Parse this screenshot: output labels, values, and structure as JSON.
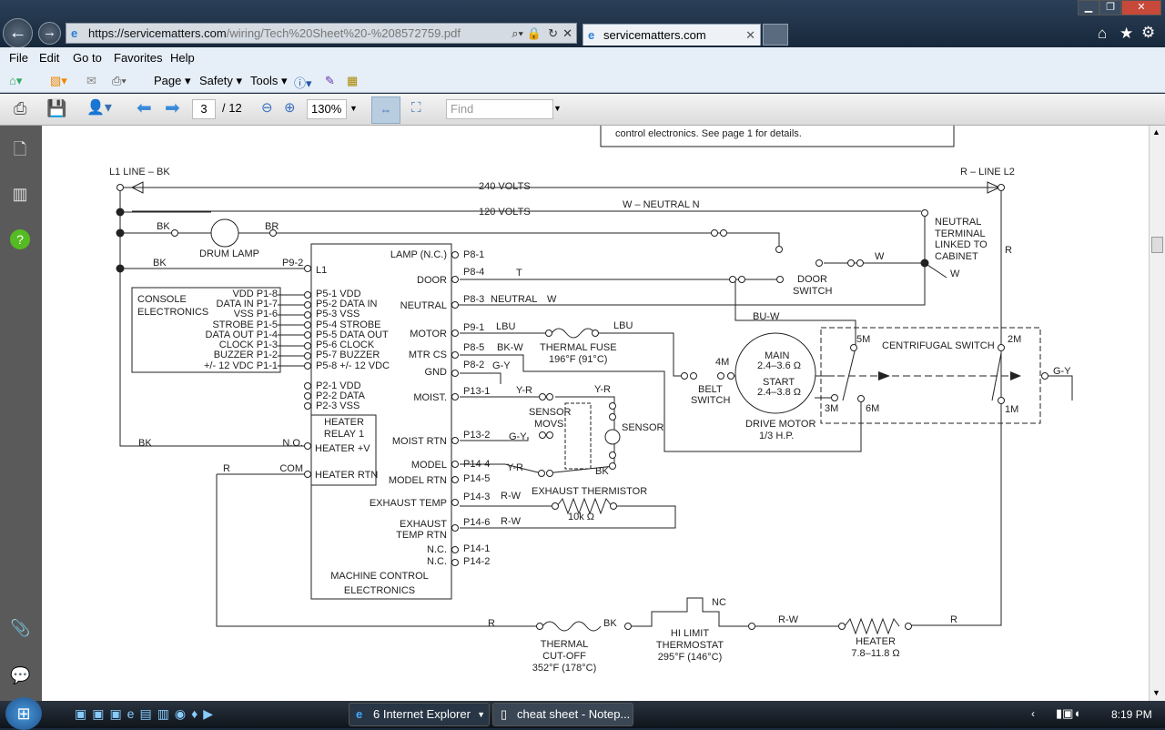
{
  "browser": {
    "url_host": "https://servicematters.com",
    "url_path": "/wiring/Tech%20Sheet%20-%208572759.pdf",
    "tab_title": "servicematters.com",
    "menu": [
      "File",
      "Edit",
      "Go to",
      "Favorites",
      "Help"
    ],
    "command_bar": [
      "Page ▾",
      "Safety ▾",
      "Tools ▾"
    ]
  },
  "pdf_toolbar": {
    "page_current": "3",
    "page_total": "/ 12",
    "zoom": "130%",
    "find_placeholder": "Find"
  },
  "taskbar": {
    "items": [
      "6 Internet Explorer",
      "cheat sheet - Notep..."
    ],
    "clock": "8:19 PM"
  },
  "diagram": {
    "labels": [
      "control electronics. See page 1 for details.",
      "L1 LINE – BK",
      "R – LINE L2",
      "240 VOLTS",
      "120 VOLTS",
      "W – NEUTRAL N",
      "BK",
      "BR",
      "DRUM LAMP",
      "NEUTRAL",
      "TERMINAL",
      "LINKED TO",
      "CABINET",
      "R",
      "BK",
      "P9-2",
      "L1",
      "LAMP (N.C.)",
      "P8-1",
      "DOOR",
      "P8-4",
      "T",
      "DOOR",
      "SWITCH",
      "W",
      "W",
      "NEUTRAL",
      "P8-3",
      "NEUTRAL",
      "W",
      "CONSOLE",
      "ELECTRONICS",
      "VDD P1-8",
      "DATA IN P1-7",
      "VSS P1-6",
      "STROBE P1-5",
      "DATA OUT P1-4",
      "CLOCK P1-3",
      "BUZZER P1-2",
      "+/- 12 VDC P1-1",
      "P5-1 VDD",
      "P5-2 DATA IN",
      "P5-3 VSS",
      "P5-4 STROBE",
      "P5-5 DATA OUT",
      "P5-6 CLOCK",
      "P5-7 BUZZER",
      "P5-8 +/- 12 VDC",
      "P2-1 VDD",
      "P2-2 DATA",
      "P2-3 VSS",
      "HEATER",
      "RELAY 1",
      "N.O.",
      "HEATER +V",
      "BK",
      "R",
      "COM",
      "HEATER RTN",
      "MOTOR",
      "P9-1",
      "LBU",
      "THERMAL FUSE",
      "196°F (91°C)",
      "LBU",
      "MTR CS",
      "P8-5",
      "BK-W",
      "GND",
      "P8-2",
      "G-Y",
      "MOIST.",
      "P13-1",
      "Y-R",
      "Y-R",
      "SENSOR",
      "MOVS",
      "SENSOR",
      "BU-W",
      "4M",
      "BELT",
      "SWITCH",
      "MAIN",
      "2.4–3.6 Ω",
      "START",
      "2.4–3.8 Ω",
      "DRIVE MOTOR",
      "1/3 H.P.",
      "5M",
      "CENTRIFUGAL SWITCH",
      "2M",
      "G-Y",
      "3M",
      "6M",
      "1M",
      "MOIST RTN",
      "P13-2",
      "G-Y",
      "Y-R",
      "BK",
      "MODEL",
      "P14-4",
      "MODEL RTN",
      "P14-5",
      "EXHAUST TEMP",
      "P14-3",
      "R-W",
      "EXHAUST THERMISTOR",
      "10k Ω",
      "EXHAUST",
      "TEMP RTN",
      "P14-6",
      "R-W",
      "N.C.",
      "P14-1",
      "N.C.",
      "P14-2",
      "MACHINE CONTROL",
      "ELECTRONICS",
      "R",
      "BK",
      "NC",
      "R-W",
      "R",
      "THERMAL",
      "CUT-OFF",
      "352°F (178°C)",
      "HI LIMIT",
      "THERMOSTAT",
      "295°F (146°C)",
      "HEATER",
      "7.8–11.8 Ω"
    ]
  }
}
